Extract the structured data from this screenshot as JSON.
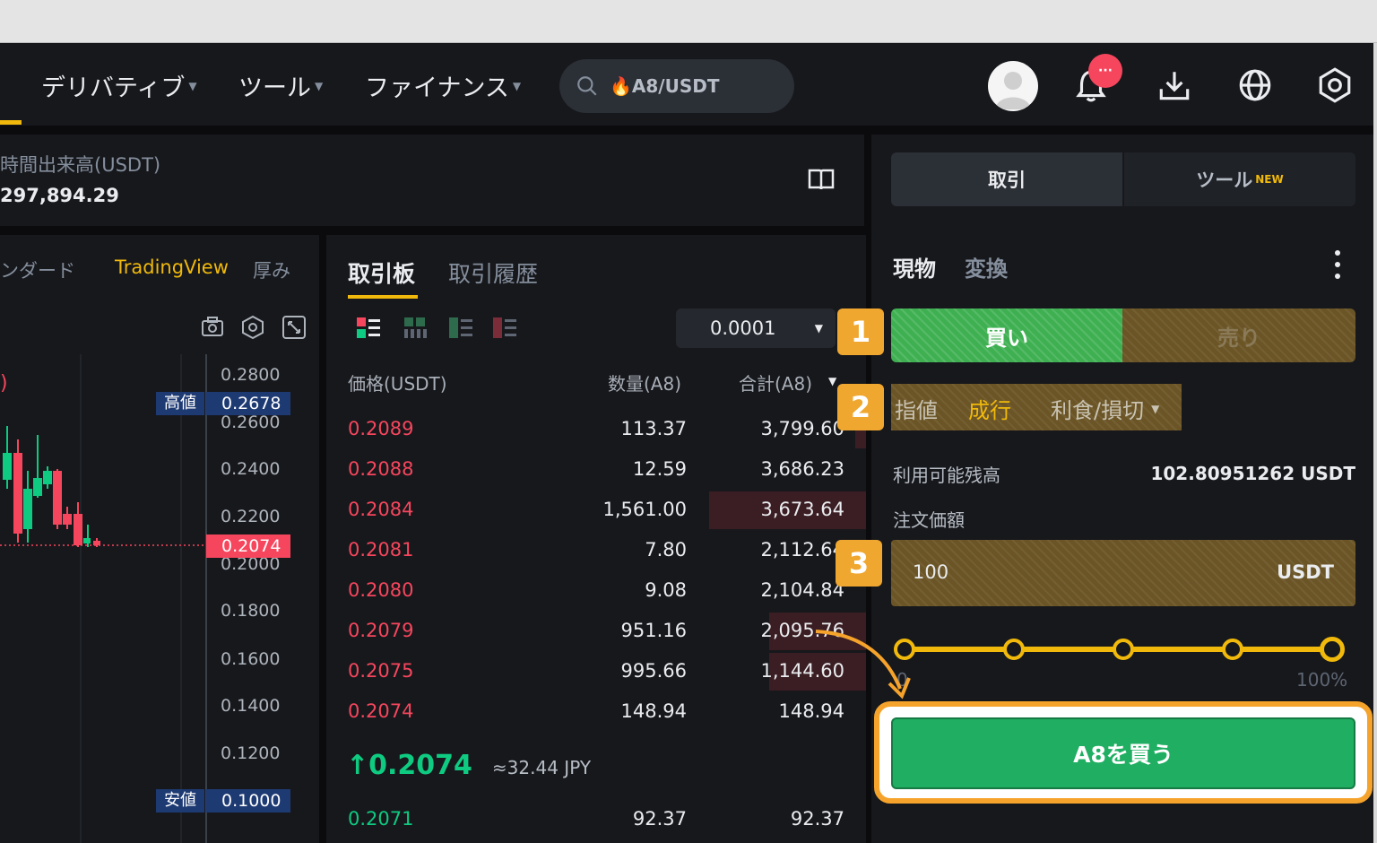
{
  "nav": {
    "items": [
      {
        "label": "デリバティブ"
      },
      {
        "label": "ツール"
      },
      {
        "label": "ファイナンス"
      }
    ],
    "search_value": "🔥A8/USDT",
    "badge": "···"
  },
  "ticker": {
    "label": "時間出来高(USDT)",
    "value": "297,894.29"
  },
  "chart": {
    "tabs": [
      "ンダード",
      "TradingView",
      "厚み"
    ],
    "axis": [
      "0.2800",
      "0.2600",
      "0.2400",
      "0.2200",
      "0.2000",
      "0.1800",
      "0.1600",
      "0.1400",
      "0.1200"
    ],
    "high_tag": "高値",
    "high_value": "0.2678",
    "low_tag": "安値",
    "low_value": "0.1000",
    "current_value": "0.2074",
    "left_marker": ")"
  },
  "orderbook": {
    "tabs": [
      "取引板",
      "取引履歴"
    ],
    "precision": "0.0001",
    "headers": {
      "price": "価格(USDT)",
      "qty": "数量(A8)",
      "total": "合計(A8)"
    },
    "asks": [
      {
        "price": "0.2089",
        "qty": "113.37",
        "total": "3,799.60",
        "depth": 0.02
      },
      {
        "price": "0.2088",
        "qty": "12.59",
        "total": "3,686.23",
        "depth": 0.0
      },
      {
        "price": "0.2084",
        "qty": "1,561.00",
        "total": "3,673.64",
        "depth": 0.29
      },
      {
        "price": "0.2081",
        "qty": "7.80",
        "total": "2,112.64",
        "depth": 0.0
      },
      {
        "price": "0.2080",
        "qty": "9.08",
        "total": "2,104.84",
        "depth": 0.0
      },
      {
        "price": "0.2079",
        "qty": "951.16",
        "total": "2,095.76",
        "depth": 0.18
      },
      {
        "price": "0.2075",
        "qty": "995.66",
        "total": "1,144.60",
        "depth": 0.18
      },
      {
        "price": "0.2074",
        "qty": "148.94",
        "total": "148.94",
        "depth": 0.0
      }
    ],
    "last_price": "0.2074",
    "last_price_jpy": "≈32.44 JPY",
    "bids": [
      {
        "price": "0.2071",
        "qty": "92.37",
        "total": "92.37"
      }
    ]
  },
  "trade": {
    "top_tabs": [
      "取引",
      "ツール"
    ],
    "new_badge": "NEW",
    "modes": [
      "現物",
      "変換"
    ],
    "buy_label": "買い",
    "sell_label": "売り",
    "order_types": [
      "指値",
      "成行",
      "利食/損切"
    ],
    "available_label": "利用可能残高",
    "available_value": "102.80951262 USDT",
    "order_amount_label": "注文価額",
    "amount_value": "100",
    "amount_unit": "USDT",
    "slider_min": "0",
    "slider_max": "100%",
    "slider_value": 1.0,
    "submit_label": "A8を買う",
    "steps": [
      "1",
      "2",
      "3"
    ]
  }
}
